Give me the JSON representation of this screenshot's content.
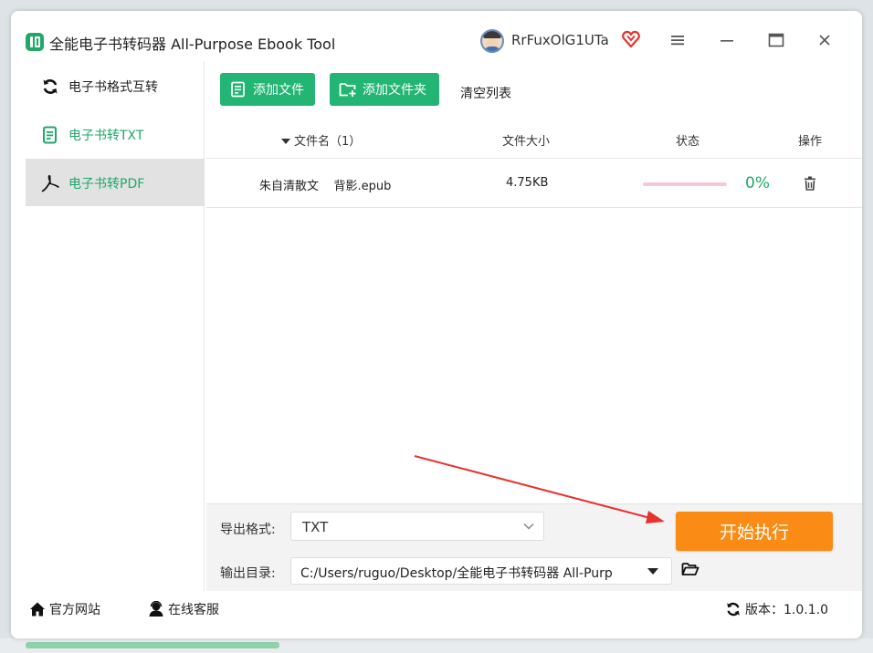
{
  "window": {
    "title": "全能电子书转码器 All-Purpose Ebook Tool",
    "username": "RrFuxOlG1UTa"
  },
  "sidebar": {
    "items": [
      {
        "label": "电子书格式互转",
        "icon": "refresh-icon"
      },
      {
        "label": "电子书转TXT",
        "icon": "document-icon"
      },
      {
        "label": "电子书转PDF",
        "icon": "pdf-icon"
      }
    ]
  },
  "toolbar": {
    "add_file": "添加文件",
    "add_folder": "添加文件夹",
    "clear_list": "清空列表"
  },
  "table": {
    "headers": {
      "name": "文件名（1）",
      "size": "文件大小",
      "status": "状态",
      "actions": "操作"
    },
    "rows": [
      {
        "name": "朱自清散文    背影.epub",
        "size": "4.75KB",
        "progress": 0,
        "percent": "0%"
      }
    ]
  },
  "settings": {
    "format_label": "导出格式:",
    "format_value": "TXT",
    "dir_label": "输出目录:",
    "dir_value": "C:/Users/ruguo/Desktop/全能电子书转码器 All-Purp"
  },
  "actions": {
    "start": "开始执行"
  },
  "footer": {
    "site": "官方网站",
    "service": "在线客服",
    "version": "版本：1.0.1.0"
  },
  "colors": {
    "accent_green": "#22b573",
    "start_orange": "#fa8c16",
    "progress_track": "#f7c8d4",
    "annotation_red": "#e8322e"
  }
}
